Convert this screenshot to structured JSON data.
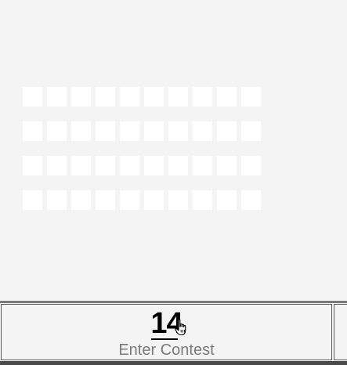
{
  "grid": {
    "rows": 4,
    "columns": 10
  },
  "contest": {
    "number": "14",
    "label": "Enter Contest"
  },
  "icons": {
    "cursor": "hand-pointer-icon"
  },
  "colors": {
    "background": "#f4f4f4",
    "placeholder": "#ffffff",
    "number": "#000000",
    "label": "#7a7a7a",
    "border": "#5c5c5c"
  }
}
